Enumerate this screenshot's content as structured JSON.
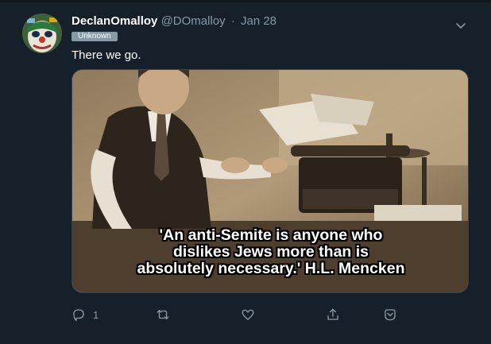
{
  "tweet": {
    "display_name": "DeclanOmalloy",
    "handle": "@DOmalloy",
    "separator": "·",
    "date": "Jan 28",
    "badge": "Unknown",
    "text": "There we go.",
    "media": {
      "caption_lines": [
        "'An anti-Semite is anyone who",
        "dislikes Jews more than is",
        "absolutely necessary.' H.L. Mencken"
      ]
    },
    "actions": {
      "reply_count": "1",
      "icons": [
        "reply-icon",
        "retweet-icon",
        "like-icon",
        "share-icon",
        "more-icon"
      ]
    }
  },
  "colors": {
    "background": "#15202b",
    "secondary_text": "#8899a6",
    "badge_bg": "#8899a6"
  }
}
